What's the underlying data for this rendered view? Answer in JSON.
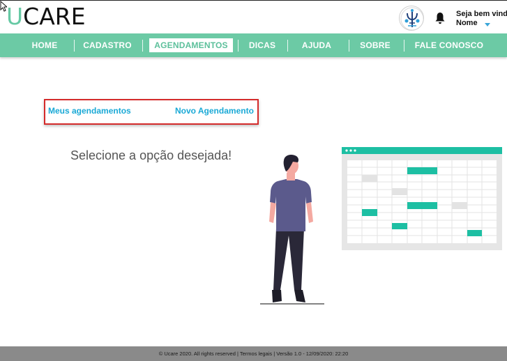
{
  "brand": {
    "logo_first": "U",
    "logo_rest": "CARE"
  },
  "header": {
    "welcome": "Seja bem vindo,",
    "user_name": "Nome"
  },
  "nav": {
    "items": [
      {
        "label": "HOME"
      },
      {
        "label": "CADASTRO"
      },
      {
        "label": "AGENDAMENTOS",
        "active": true
      },
      {
        "label": "DICAS"
      },
      {
        "label": "AJUDA"
      },
      {
        "label": "SOBRE"
      },
      {
        "label": "FALE CONOSCO"
      }
    ]
  },
  "options": {
    "my_appointments": "Meus agendamentos",
    "new_appointment": "Novo Agendamento"
  },
  "prompt": "Selecione a opção desejada!",
  "footer": {
    "text": "© Ucare  2020. All rights reserved | Termos legais | Versão 1.0 - 12/09/2020: 22:20"
  },
  "colors": {
    "brand_green": "#6ccaa5",
    "link_blue": "#1aa9d6",
    "highlight_red": "#d42a2a",
    "calendar_teal": "#1dbfa3",
    "footer_gray": "#8a8a8a"
  },
  "icons": {
    "cursor": "arrow-cursor-icon",
    "bell": "bell-icon",
    "dropdown": "caret-down-icon",
    "emblem": "university-emblem-icon"
  }
}
